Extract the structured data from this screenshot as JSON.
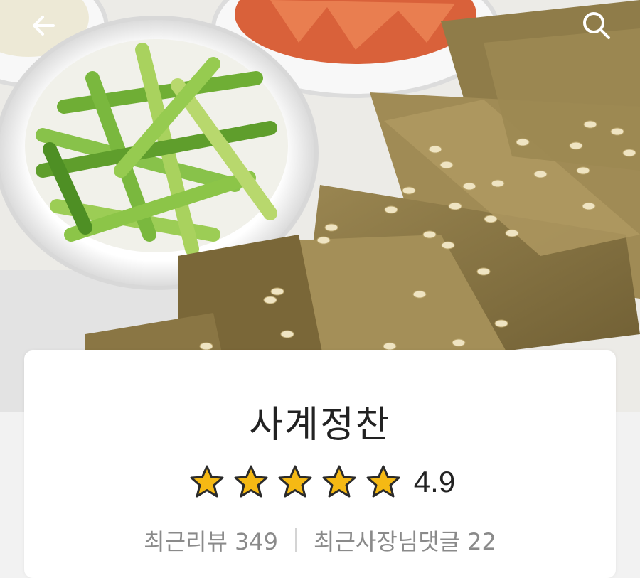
{
  "header": {
    "back_icon": "arrow-left-icon",
    "search_icon": "search-icon"
  },
  "hero": {
    "description_icon": "food-photo"
  },
  "store": {
    "name": "사계정찬",
    "rating": "4.9",
    "rating_stars": 5,
    "recent_reviews_label": "최근리뷰",
    "recent_reviews_count": "349",
    "owner_replies_label": "최근사장님댓글",
    "owner_replies_count": "22"
  },
  "colors": {
    "star_fill": "#F5B914",
    "star_stroke": "#2a2a2a",
    "text_primary": "#222222",
    "text_secondary": "#8a8a8a"
  }
}
